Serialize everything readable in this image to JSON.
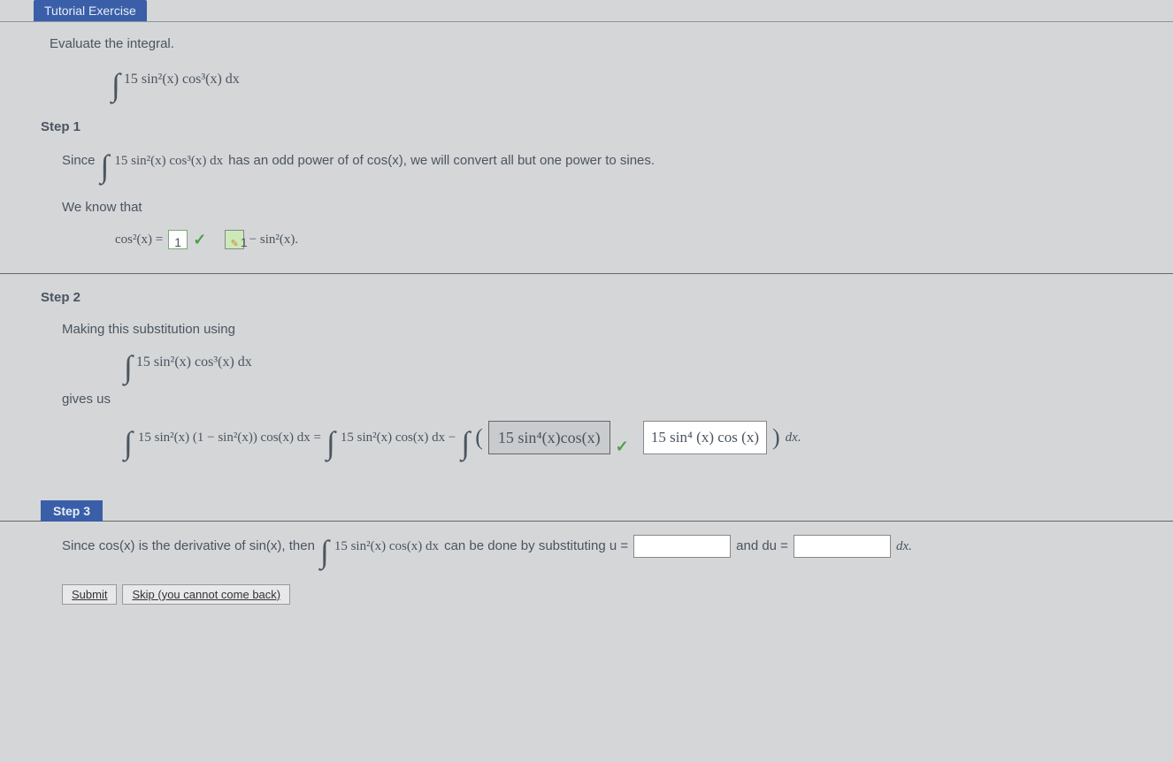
{
  "header": {
    "tab": "Tutorial Exercise"
  },
  "prompt": "Evaluate the integral.",
  "integral_main": "15 sin²(x) cos³(x) dx",
  "step1": {
    "title": "Step 1",
    "since": "Since",
    "since_integral": "15 sin²(x) cos³(x) dx",
    "since_tail": "has an odd power of of cos(x), we will convert all but one power to sines.",
    "we_know": "We know that",
    "cos2_lhs": "cos²(x) =",
    "box_a": "1",
    "box_b": "1",
    "minus_sin2": "− sin²(x)."
  },
  "step2": {
    "title": "Step 2",
    "making": "Making this substitution using",
    "sub_integral": "15 sin²(x) cos³(x) dx",
    "gives_us": "gives us",
    "expand_lhs": "15 sin²(x) (1 − sin²(x)) cos(x) dx =",
    "expand_mid": "15 sin²(x) cos(x) dx −",
    "answer_box": "15 sin⁴(x)cos(x)",
    "answer_display": "15 sin⁴ (x) cos (x)",
    "dx_tail": "dx."
  },
  "step3": {
    "title": "Step 3",
    "line_a": "Since cos(x) is the derivative of sin(x), then",
    "line_integral": "15 sin²(x) cos(x) dx",
    "line_b": "can be done by substituting u =",
    "and_du": "and du =",
    "dx": "dx."
  },
  "buttons": {
    "submit": "Submit",
    "skip": "Skip (you cannot come back)"
  }
}
